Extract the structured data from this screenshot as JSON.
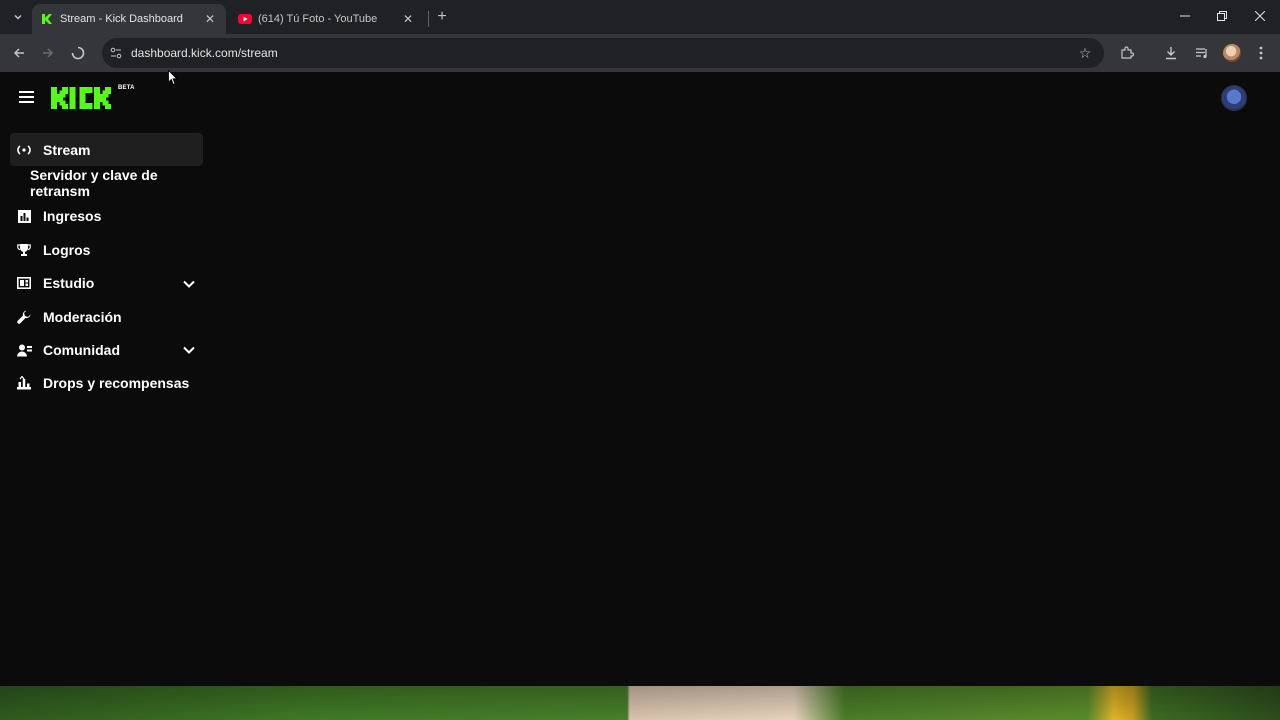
{
  "browser": {
    "tabs": [
      {
        "title": "Stream - Kick Dashboard",
        "favicon": "kick-favicon",
        "active": true
      },
      {
        "title": "(614) Tú Foto - YouTube",
        "favicon": "youtube-favicon",
        "active": false
      }
    ],
    "url": "dashboard.kick.com/stream"
  },
  "app": {
    "logo_text": "KICK",
    "logo_badge": "BETA",
    "brand_color": "#53fc18"
  },
  "sidebar": {
    "items": [
      {
        "label": "Stream",
        "icon": "broadcast-icon",
        "active": true
      },
      {
        "label": "Servidor y clave de retransm",
        "icon": null,
        "sub": true
      },
      {
        "label": "Ingresos",
        "icon": "bar-chart-icon"
      },
      {
        "label": "Logros",
        "icon": "trophy-icon"
      },
      {
        "label": "Estudio",
        "icon": "studio-icon",
        "expandable": true
      },
      {
        "label": "Moderación",
        "icon": "wrench-icon"
      },
      {
        "label": "Comunidad",
        "icon": "community-icon",
        "expandable": true
      },
      {
        "label": "Drops y recompensas",
        "icon": "drops-icon"
      }
    ]
  }
}
